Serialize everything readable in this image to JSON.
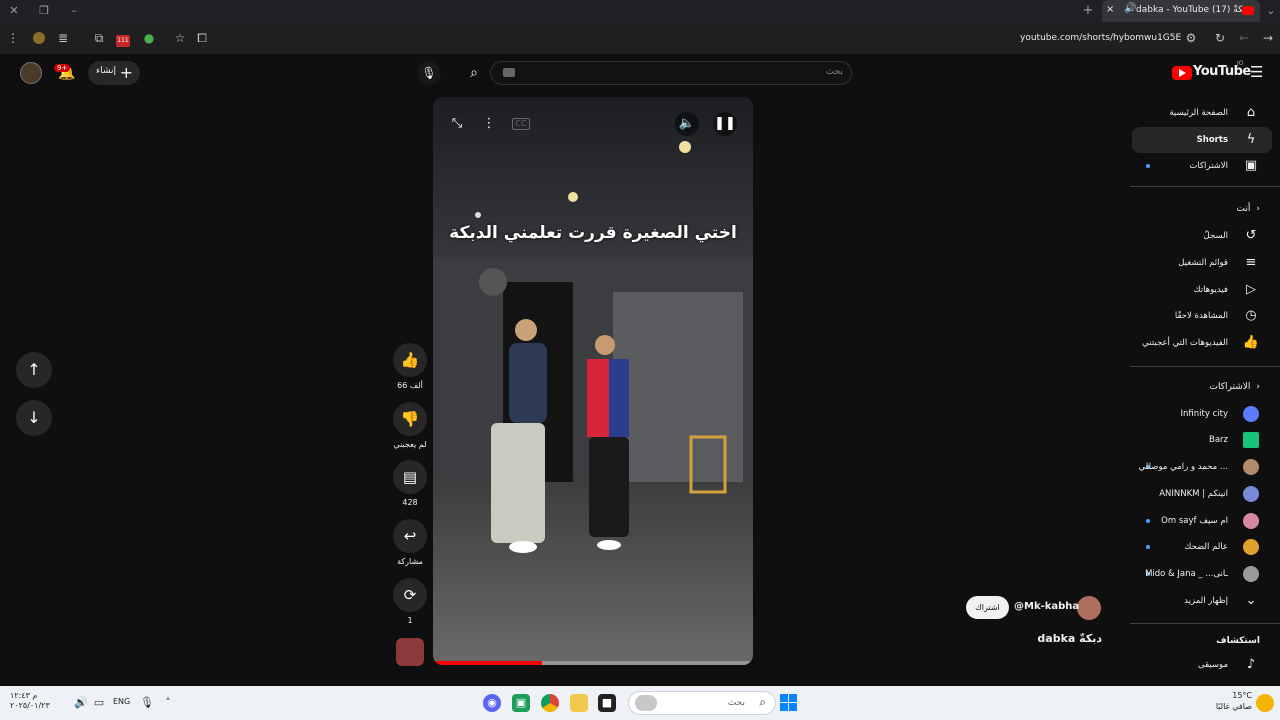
{
  "browser": {
    "tab_title": "dabka - YouTube (17) دبكةّ",
    "url": "youtube.com/shorts/hybomwu1G5E",
    "new_tab_symbol": "+",
    "tab_close_symbol": "×",
    "extension_badge": "111"
  },
  "header": {
    "logo_text": "YouTube",
    "logo_region": "JO",
    "search_placeholder": "بحث",
    "create_label": "إنشاء",
    "notification_badge": "9+"
  },
  "sidebar": {
    "main": [
      {
        "label": "الصفحة الرئيسية",
        "icon": "home-icon"
      },
      {
        "label": "Shorts",
        "icon": "shorts-icon",
        "active": true
      },
      {
        "label": "الاشتراكات",
        "icon": "subscriptions-icon",
        "dot": true
      }
    ],
    "you_header": "أنت",
    "you": [
      {
        "label": "السجلّ",
        "icon": "history-icon"
      },
      {
        "label": "قوائم التشغيل",
        "icon": "playlist-icon"
      },
      {
        "label": "فيديوهاتك",
        "icon": "your-videos-icon"
      },
      {
        "label": "المشاهدة لاحقًا",
        "icon": "watch-later-icon"
      },
      {
        "label": "الفيديوهات التي أعجبتني",
        "icon": "liked-icon"
      }
    ],
    "subs_header": "الاشتراكات",
    "subs": [
      {
        "label": "Infinity city",
        "color": "#5b7cff"
      },
      {
        "label": "Barz",
        "color": "#19c37d"
      },
      {
        "label": "محمد و رامي موصللي ...",
        "color": "#b08a6a",
        "dot": true
      },
      {
        "label": "ANINNKM | انينكم",
        "color": "#7a8ad6"
      },
      {
        "label": "Om sayf ام سيف",
        "color": "#d68aa0",
        "dot": true
      },
      {
        "label": "عالم الضحك",
        "color": "#e0a030",
        "dot": true
      },
      {
        "label": "Mido & Jana _ ...ـانى",
        "color": "#9a9a9a",
        "dot": true
      }
    ],
    "show_more": "إظهار المزيد",
    "explore_header": "استكشاف",
    "explore": [
      {
        "label": "موسيقى",
        "icon": "music-icon"
      }
    ]
  },
  "short": {
    "caption_overlay": "اختي الصغيرة قررت تعلمني الدبكة",
    "channel": "@Mk-kabha",
    "subscribe_label": "اشتراك",
    "title": "dabka دبكةّ",
    "progress": 0.34
  },
  "actions": {
    "likes": "66 ألف",
    "dislike_label": "لم يعجبني",
    "comments": "428",
    "share_label": "مشاركة",
    "remix": "1"
  },
  "taskbar": {
    "search_placeholder": "بحث",
    "lang": "ENG",
    "time": "م ١٢:٤٣",
    "date": "٢٠٢٥/٠١/٢٣",
    "weather_temp": "15°C",
    "weather_desc": "صافي غالبًا"
  },
  "colors": {
    "accent_red": "#ff0000",
    "link_blue": "#3ea6ff"
  }
}
